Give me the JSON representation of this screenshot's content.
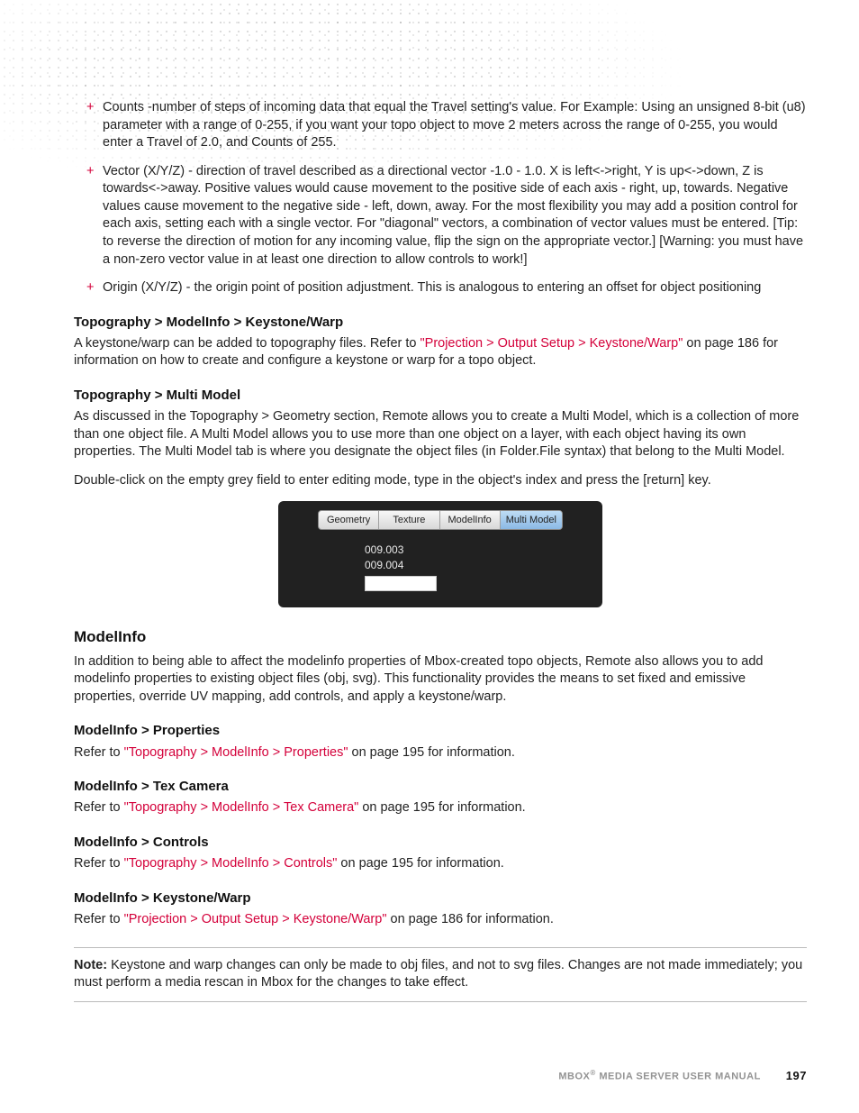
{
  "bullets": {
    "counts": "Counts -number of steps of incoming data that equal the Travel setting's value. For Example: Using an unsigned 8-bit (u8) parameter with a range of 0-255, if you want your topo object to move 2 meters across the range of 0-255, you would enter a Travel of 2.0, and Counts of 255.",
    "vector": "Vector (X/Y/Z) - direction of travel described as a directional vector -1.0 - 1.0. X is left<->right, Y is up<->down, Z is towards<->away. Positive values would cause movement to the positive side of each axis - right, up, towards. Negative values cause movement to the negative side - left, down, away. For the most flexibility you may add a position control for each axis, setting each with a single vector. For \"diagonal\" vectors, a combination of vector values must be entered. [Tip: to reverse the direction of motion for any incoming value, flip the sign on the appropriate vector.] [Warning: you must have a non-zero vector value in at least one direction to allow controls to work!]",
    "origin": "Origin (X/Y/Z) - the origin point of position adjustment. This is analogous to entering an offset for object positioning"
  },
  "sections": {
    "keystone": {
      "heading": "Topography > ModelInfo > Keystone/Warp",
      "prefix": "A keystone/warp can be added to topography files. Refer to ",
      "link": "\"Projection > Output Setup > Keystone/Warp\"",
      "suffix": " on page 186 for information on how to create and configure a keystone or warp for a topo object."
    },
    "multimodel": {
      "heading": "Topography > Multi Model",
      "p1": "As discussed in the Topography > Geometry section, Remote allows you to create a Multi Model, which is a collection of more than one object file. A Multi Model allows you to use more than one object on a layer, with each object having its own properties. The Multi Model tab is where you designate the object files (in Folder.File syntax) that belong to the Multi Model.",
      "p2": "Double-click on the empty grey field to enter editing mode, type in the object's index and press the [return] key."
    },
    "modelinfo": {
      "heading": "ModelInfo",
      "intro": "In addition to being able to affect the modelinfo properties of Mbox-created topo objects, Remote also allows you to add modelinfo properties to existing object files (obj, svg). This functionality provides the means to set fixed and emissive properties, override UV mapping, add controls, and apply a keystone/warp."
    },
    "mi_properties": {
      "heading": "ModelInfo > Properties",
      "prefix": "Refer to ",
      "link": "\"Topography > ModelInfo > Properties\"",
      "suffix": " on page 195 for information."
    },
    "mi_texcam": {
      "heading": "ModelInfo > Tex Camera",
      "prefix": "Refer to ",
      "link": "\"Topography > ModelInfo > Tex Camera\"",
      "suffix": " on page 195 for information."
    },
    "mi_controls": {
      "heading": "ModelInfo > Controls",
      "prefix": "Refer to ",
      "link": "\"Topography > ModelInfo > Controls\"",
      "suffix": " on page 195 for information."
    },
    "mi_keystone": {
      "heading": "ModelInfo > Keystone/Warp",
      "prefix": "Refer to ",
      "link": "\"Projection > Output Setup > Keystone/Warp\"",
      "suffix": " on page 186 for information."
    }
  },
  "figure": {
    "tabs": {
      "geometry": "Geometry",
      "texture": "Texture",
      "modelinfo": "ModelInfo",
      "multimodel": "Multi Model"
    },
    "rows": {
      "r1": "009.003",
      "r2": "009.004"
    }
  },
  "note": {
    "label": "Note:",
    "text": " Keystone and warp changes can only be made to obj files, and not to svg files. Changes are not made immediately; you must perform a media rescan in Mbox for the changes to take effect."
  },
  "footer": {
    "title_a": "MBOX",
    "title_b": " MEDIA SERVER USER MANUAL",
    "page": "197"
  }
}
